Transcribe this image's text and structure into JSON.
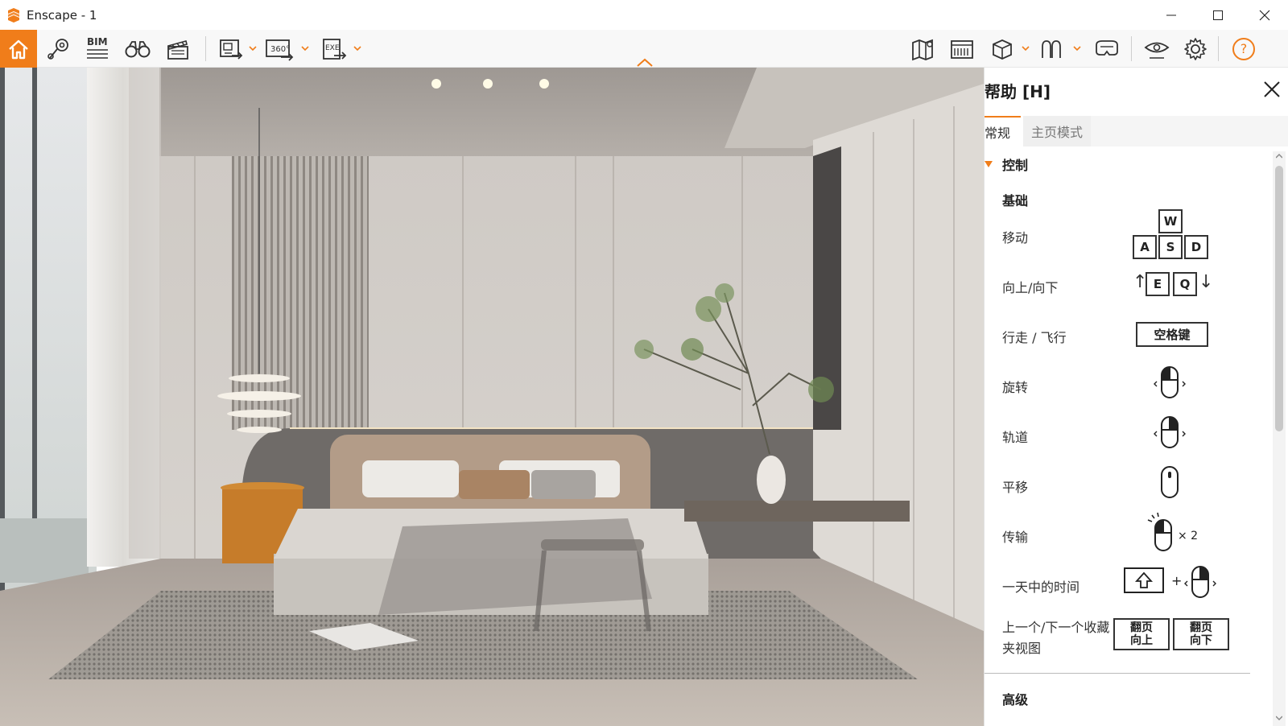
{
  "window": {
    "title": "Enscape - 1",
    "accent_color": "#f07d1a"
  },
  "toolbar": {
    "bim_label": "BIM",
    "pano_label": "360°",
    "exe_label": "EXE",
    "help_glyph": "?"
  },
  "help_panel": {
    "title": "帮助 [H]",
    "tabs": [
      {
        "label": "常规",
        "active": true
      },
      {
        "label": "主页模式",
        "active": false
      }
    ],
    "section": "控制",
    "subsection": "基础",
    "rows": [
      {
        "label": "移动",
        "keys": [
          "W",
          "A",
          "S",
          "D"
        ]
      },
      {
        "label": "向上/向下",
        "keys": [
          "E",
          "Q"
        ],
        "arrows": [
          "↑",
          "↓"
        ]
      },
      {
        "label": "行走 / 飞行",
        "keys": [
          "空格键"
        ]
      },
      {
        "label": "旋转",
        "icon": "mouse-left-drag-icon"
      },
      {
        "label": "轨道",
        "icon": "mouse-right-drag-icon"
      },
      {
        "label": "平移",
        "icon": "mouse-middle-drag-icon"
      },
      {
        "label": "传输",
        "icon": "mouse-double-click-icon",
        "suffix": "× 2"
      },
      {
        "label": "一天中的时间",
        "icon": "shift-plus-right-mouse-icon",
        "plus": "+"
      },
      {
        "label": "上一个/下一个收藏夹视图",
        "label_line1": "上一个/下一个收藏",
        "label_line2": "夹视图",
        "keys": [
          "翻页\n向上",
          "翻页\n向下"
        ]
      }
    ],
    "advanced": "高级"
  }
}
